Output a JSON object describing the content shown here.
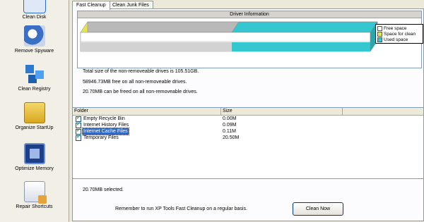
{
  "sidebar": {
    "items": [
      {
        "label": "Clean Disk",
        "icon": "disk-icon"
      },
      {
        "label": "Remove Spyware",
        "icon": "shield-icon"
      },
      {
        "label": "Clean Registry",
        "icon": "registry-icon"
      },
      {
        "label": "Organize StartUp",
        "icon": "startup-box-icon"
      },
      {
        "label": "Optimize Memory",
        "icon": "memory-chip-icon"
      },
      {
        "label": "Repair Shortcuts",
        "icon": "shortcut-icon"
      }
    ]
  },
  "tabs": [
    {
      "label": "Fast Cleanup"
    },
    {
      "label": "Clean Junk Files"
    }
  ],
  "driver_info": {
    "title": "Driver Information",
    "legend": [
      {
        "label": "Free space",
        "color": "#ffffff"
      },
      {
        "label": "Space for clean",
        "color": "#e6e64a"
      },
      {
        "label": "Used space",
        "color": "#34c7cf"
      }
    ],
    "colors": {
      "gray": "#c0c0c0",
      "cyan": "#34c7cf",
      "yellow": "#e6e64a"
    }
  },
  "summary": {
    "line1": "Total size of the non-removeable drives is 105.51GB.",
    "line2": "58946.73MB free on all non-removeable drives.",
    "line3": "20.70MB can be freed on all non-removeable drives."
  },
  "file_list": {
    "columns": [
      "Folder",
      "Size"
    ],
    "rows": [
      {
        "name": "Empty Recycle Bin",
        "size": "0.00M",
        "checked": true
      },
      {
        "name": "Internet History Files",
        "size": "0.09M",
        "checked": true
      },
      {
        "name": "Internet Cache Files",
        "size": "0.11M",
        "checked": true
      },
      {
        "name": "Temporary Files",
        "size": "20.50M",
        "checked": true
      }
    ],
    "selected_index": 2
  },
  "status": {
    "selected": "20.70MB selected.",
    "reminder": "Remember to run XP Tools Fast Cleanup on a regular basis."
  },
  "button": {
    "clean_now": "Clean Now"
  }
}
